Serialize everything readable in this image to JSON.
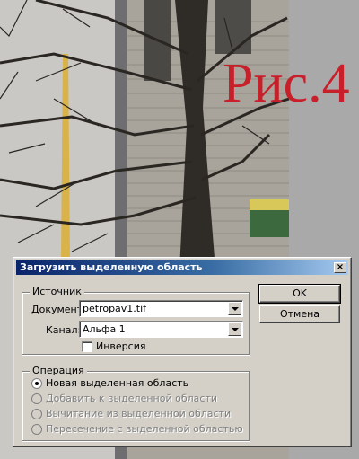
{
  "figure_label": "Рис.4",
  "dialog": {
    "title": "Загрузить выделенную область",
    "close_glyph": "×",
    "source": {
      "legend": "Источник",
      "document_label": "Документ:",
      "document_value": "petropav1.tif",
      "channel_label": "Канал:",
      "channel_value": "Альфа 1",
      "invert_label": "Инверсия",
      "invert_checked": false
    },
    "operation": {
      "legend": "Операция",
      "options": [
        {
          "label": "Новая выделенная область",
          "selected": true,
          "enabled": true
        },
        {
          "label": "Добавить к выделенной области",
          "selected": false,
          "enabled": false
        },
        {
          "label": "Вычитание из выделенной области",
          "selected": false,
          "enabled": false
        },
        {
          "label": "Пересечение с выделенной областью",
          "selected": false,
          "enabled": false
        }
      ]
    },
    "ok_label": "OK",
    "cancel_label": "Отмена"
  }
}
